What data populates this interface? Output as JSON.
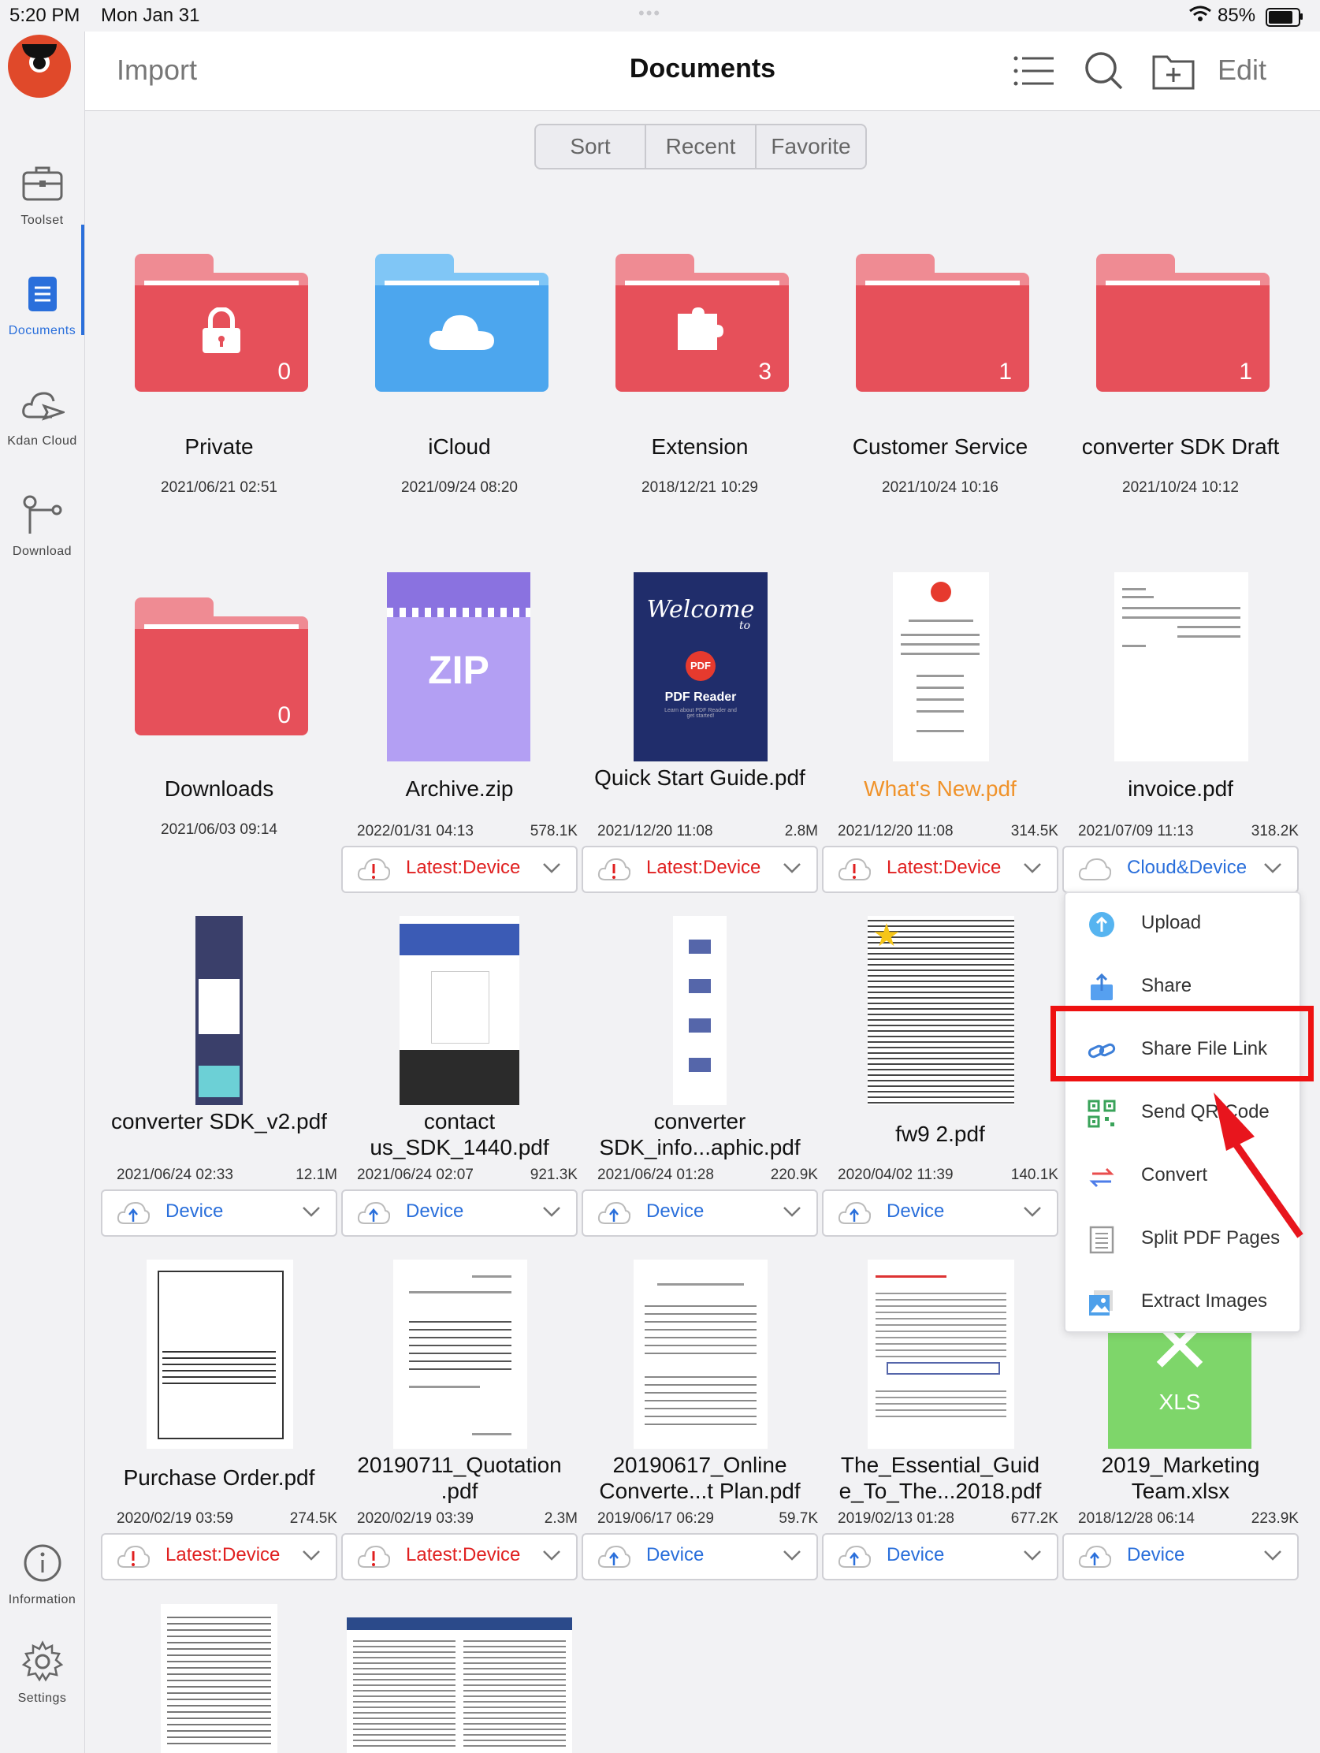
{
  "status_bar": {
    "time": "5:20 PM",
    "date": "Mon Jan 31",
    "battery": "85%"
  },
  "sidebar": {
    "items": [
      {
        "label": "Toolset"
      },
      {
        "label": "Documents"
      },
      {
        "label": "Kdan Cloud"
      },
      {
        "label": "Download"
      },
      {
        "label": "Information"
      },
      {
        "label": "Settings"
      }
    ]
  },
  "topbar": {
    "import": "Import",
    "title": "Documents",
    "edit": "Edit"
  },
  "segments": [
    "Sort",
    "Recent",
    "Favorite"
  ],
  "folders": [
    {
      "name": "Private",
      "date": "2021/06/21 02:51",
      "count": "0",
      "color": "#e6505a",
      "icon": "lock-icon"
    },
    {
      "name": "iCloud",
      "date": "2021/09/24 08:20",
      "count": "",
      "color": "#4ca6ee",
      "icon": "cloud-icon"
    },
    {
      "name": "Extension",
      "date": "2018/12/21 10:29",
      "count": "3",
      "color": "#e6505a",
      "icon": "puzzle-icon"
    },
    {
      "name": "Customer Service",
      "date": "2021/10/24 10:16",
      "count": "1",
      "color": "#e6505a",
      "icon": ""
    },
    {
      "name": "converter SDK Draft",
      "date": "2021/10/24 10:12",
      "count": "1",
      "color": "#e6505a",
      "icon": ""
    },
    {
      "name": "Downloads",
      "date": "2021/06/03 09:14",
      "count": "0",
      "color": "#e6505a",
      "icon": ""
    }
  ],
  "files_row2": [
    {
      "name": "Archive.zip",
      "date": "2022/01/31 04:13",
      "size": "578.1K",
      "status": "Latest:Device"
    },
    {
      "name": "Quick Start Guide.pdf",
      "date": "2021/12/20 11:08",
      "size": "2.8M",
      "status": "Latest:Device",
      "thumb_text": {
        "welcome": "Welcome",
        "to": "to",
        "pdf": "PDF",
        "reader": "PDF Reader",
        "sub": "Learn about PDF Reader and get started!"
      }
    },
    {
      "name": "What's New.pdf",
      "date": "2021/12/20 11:08",
      "size": "314.5K",
      "status": "Latest:Device"
    },
    {
      "name": "invoice.pdf",
      "date": "2021/07/09 11:13",
      "size": "318.2K",
      "status": "Cloud&Device"
    }
  ],
  "files_row3": [
    {
      "name": "converter SDK_v2.pdf",
      "date": "2021/06/24 02:33",
      "size": "12.1M",
      "status": "Device"
    },
    {
      "name": "contact us_SDK_1440.pdf",
      "date": "2021/06/24 02:07",
      "size": "921.3K",
      "status": "Device"
    },
    {
      "name": "converter SDK_info...aphic.pdf",
      "date": "2021/06/24 01:28",
      "size": "220.9K",
      "status": "Device"
    },
    {
      "name": "fw9 2.pdf",
      "date": "2020/04/02 11:39",
      "size": "140.1K",
      "status": "Device"
    }
  ],
  "files_row4": [
    {
      "name": "Purchase Order.pdf",
      "date": "2020/02/19 03:59",
      "size": "274.5K",
      "status": "Latest:Device"
    },
    {
      "name": "20190711_Quotation .pdf",
      "date": "2020/02/19 03:39",
      "size": "2.3M",
      "status": "Latest:Device"
    },
    {
      "name": "20190617_Online Converte...t Plan.pdf",
      "date": "2019/06/17 06:29",
      "size": "59.7K",
      "status": "Device"
    },
    {
      "name": "The_Essential_Guid e_To_The...2018.pdf",
      "date": "2019/02/13 01:28",
      "size": "677.2K",
      "status": "Device"
    },
    {
      "name": "2019_Marketing Team.xlsx",
      "date": "2018/12/28 06:14",
      "size": "223.9K",
      "status": "Device"
    }
  ],
  "thumb_labels": {
    "zip": "ZIP",
    "xls": "XLS"
  },
  "menu": {
    "items": [
      {
        "label": "Upload",
        "icon": "upload-icon"
      },
      {
        "label": "Share",
        "icon": "share-icon"
      },
      {
        "label": "Share File Link",
        "icon": "link-icon"
      },
      {
        "label": "Send QR Code",
        "icon": "qr-code-icon"
      },
      {
        "label": "Convert",
        "icon": "convert-icon"
      },
      {
        "label": "Split PDF Pages",
        "icon": "split-pages-icon"
      },
      {
        "label": "Extract Images",
        "icon": "image-icon"
      }
    ]
  }
}
